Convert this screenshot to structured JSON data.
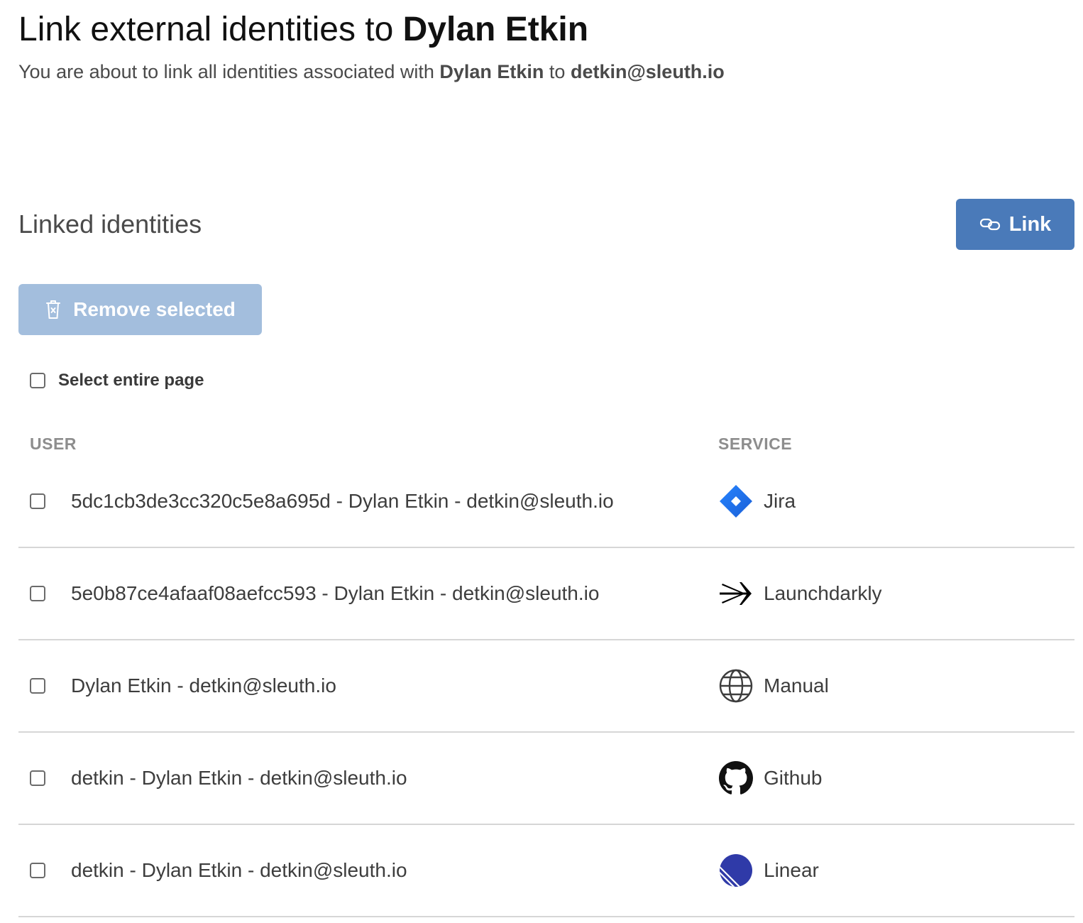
{
  "header": {
    "title_prefix": "Link external identities to ",
    "title_name": "Dylan Etkin",
    "subtitle_prefix": "You are about to link all identities associated with ",
    "subtitle_name": "Dylan Etkin",
    "subtitle_mid": " to ",
    "subtitle_email": "detkin@sleuth.io"
  },
  "section": {
    "title": "Linked identities",
    "link_button": {
      "label": "Link",
      "icon": "link-icon",
      "color": "#4a7ab9"
    },
    "remove_button": {
      "label": "Remove selected",
      "icon": "trash-icon",
      "color": "#a3bedd",
      "disabled": true
    },
    "select_all_label": "Select entire page"
  },
  "table": {
    "columns": [
      "USER",
      "SERVICE"
    ],
    "rows": [
      {
        "user": "5dc1cb3de3cc320c5e8a695d - Dylan Etkin - detkin@sleuth.io",
        "service": "Jira",
        "icon": "jira-icon",
        "checked": false
      },
      {
        "user": "5e0b87ce4afaaf08aefcc593 - Dylan Etkin - detkin@sleuth.io",
        "service": "Launchdarkly",
        "icon": "launchdarkly-icon",
        "checked": false
      },
      {
        "user": "Dylan Etkin - detkin@sleuth.io",
        "service": "Manual",
        "icon": "globe-icon",
        "checked": false
      },
      {
        "user": "detkin - Dylan Etkin - detkin@sleuth.io",
        "service": "Github",
        "icon": "github-icon",
        "checked": false
      },
      {
        "user": "detkin - Dylan Etkin - detkin@sleuth.io",
        "service": "Linear",
        "icon": "linear-icon",
        "checked": false
      }
    ]
  }
}
